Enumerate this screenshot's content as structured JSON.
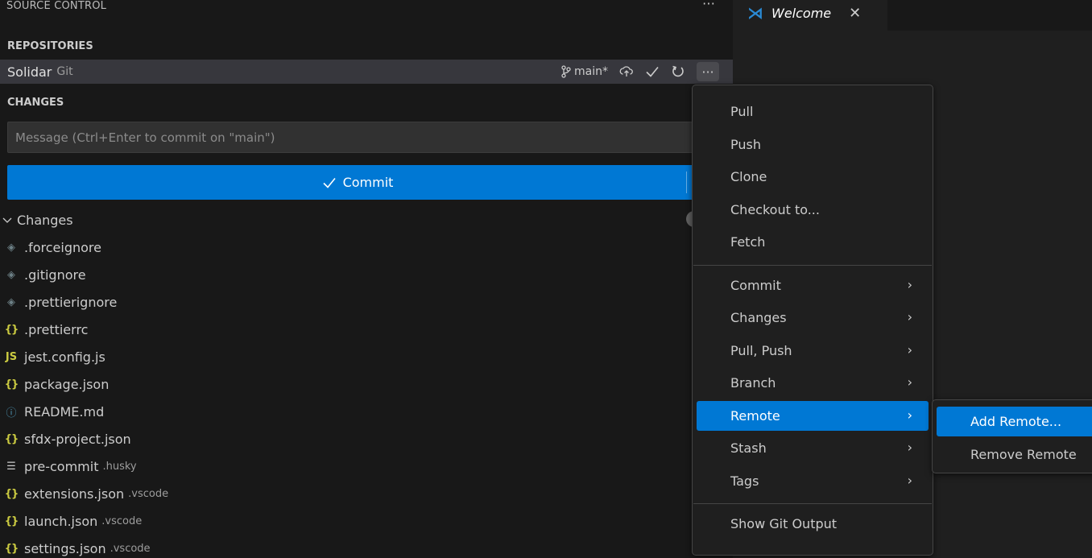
{
  "view": {
    "title": "SOURCE CONTROL",
    "more": "···"
  },
  "repositories": {
    "header": "REPOSITORIES",
    "repo": {
      "name": "Solidar",
      "kind": "Git",
      "branch": "main*"
    }
  },
  "changes_section": {
    "header": "CHANGES",
    "message_placeholder": "Message (Ctrl+Enter to commit on \"main\")",
    "commit_label": "Commit",
    "group_label": "Changes"
  },
  "files": [
    {
      "name": ".forceignore",
      "desc": "",
      "icon": "config-icon"
    },
    {
      "name": ".gitignore",
      "desc": "",
      "icon": "config-icon"
    },
    {
      "name": ".prettierignore",
      "desc": "",
      "icon": "config-icon"
    },
    {
      "name": ".prettierrc",
      "desc": "",
      "icon": "json-icon"
    },
    {
      "name": "jest.config.js",
      "desc": "",
      "icon": "js-icon"
    },
    {
      "name": "package.json",
      "desc": "",
      "icon": "json-icon"
    },
    {
      "name": "README.md",
      "desc": "",
      "icon": "info-icon"
    },
    {
      "name": "sfdx-project.json",
      "desc": "",
      "icon": "json-icon"
    },
    {
      "name": "pre-commit",
      "desc": ".husky",
      "icon": "text-lines-icon"
    },
    {
      "name": "extensions.json",
      "desc": ".vscode",
      "icon": "json-icon"
    },
    {
      "name": "launch.json",
      "desc": ".vscode",
      "icon": "json-icon"
    },
    {
      "name": "settings.json",
      "desc": ".vscode",
      "icon": "json-icon"
    }
  ],
  "editor": {
    "tab_label": "Welcome"
  },
  "menu": {
    "group1": [
      "Pull",
      "Push",
      "Clone",
      "Checkout to...",
      "Fetch"
    ],
    "group2": [
      "Commit",
      "Changes",
      "Pull, Push",
      "Branch",
      "Remote",
      "Stash",
      "Tags"
    ],
    "group3": [
      "Show Git Output"
    ],
    "active": "Remote"
  },
  "submenu": {
    "items": [
      "Add Remote...",
      "Remove Remote"
    ],
    "active": "Add Remote..."
  },
  "colors": {
    "accent": "#0078d4",
    "sidebar_bg": "#181818",
    "menu_bg": "#1f1f1f"
  }
}
